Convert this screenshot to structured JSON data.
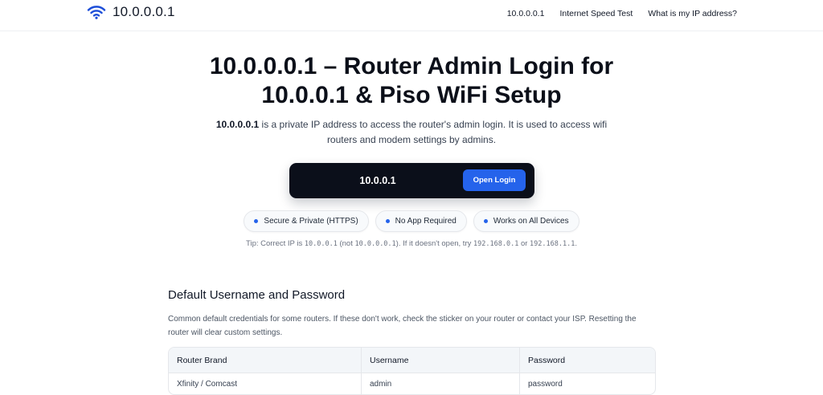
{
  "header": {
    "brand": "10.0.0.0.1",
    "brand_icon": "wifi-icon",
    "nav": [
      {
        "label": "10.0.0.0.1"
      },
      {
        "label": "Internet Speed Test"
      },
      {
        "label": "What is my IP address?"
      }
    ]
  },
  "hero": {
    "title_line1": "10.0.0.0.1 – Router Admin Login for",
    "title_line2": "10.0.0.1 & Piso WiFi Setup",
    "desc_bold": "10.0.0.0.1",
    "desc_rest": " is a private IP address to access the router's admin login. It is used to access wifi routers and modem settings by admins."
  },
  "login": {
    "ip_value": "10.0.0.1",
    "button_label": "Open Login"
  },
  "badges": [
    {
      "label": "Secure & Private (HTTPS)"
    },
    {
      "label": "No App Required"
    },
    {
      "label": "Works on All Devices"
    }
  ],
  "tip": {
    "prefix": "Tip: Correct IP is ",
    "correct_ip": "10.0.0.1",
    "not_text": " (not ",
    "wrong_ip": "10.0.0.0.1",
    "mid": "). If it doesn't open, try ",
    "alt1": "192.168.0.1",
    "or_text": " or ",
    "alt2": "192.168.1.1",
    "suffix": "."
  },
  "credentials": {
    "title": "Default Username and Password",
    "desc": "Common default credentials for some routers. If these don't work, check the sticker on your router or contact your ISP. Resetting the router will clear custom settings.",
    "columns": [
      "Router Brand",
      "Username",
      "Password"
    ],
    "rows": [
      [
        "Xfinity / Comcast",
        "admin",
        "password"
      ]
    ]
  },
  "colors": {
    "accent": "#2563eb",
    "login_bar": "#0b0f1a"
  }
}
